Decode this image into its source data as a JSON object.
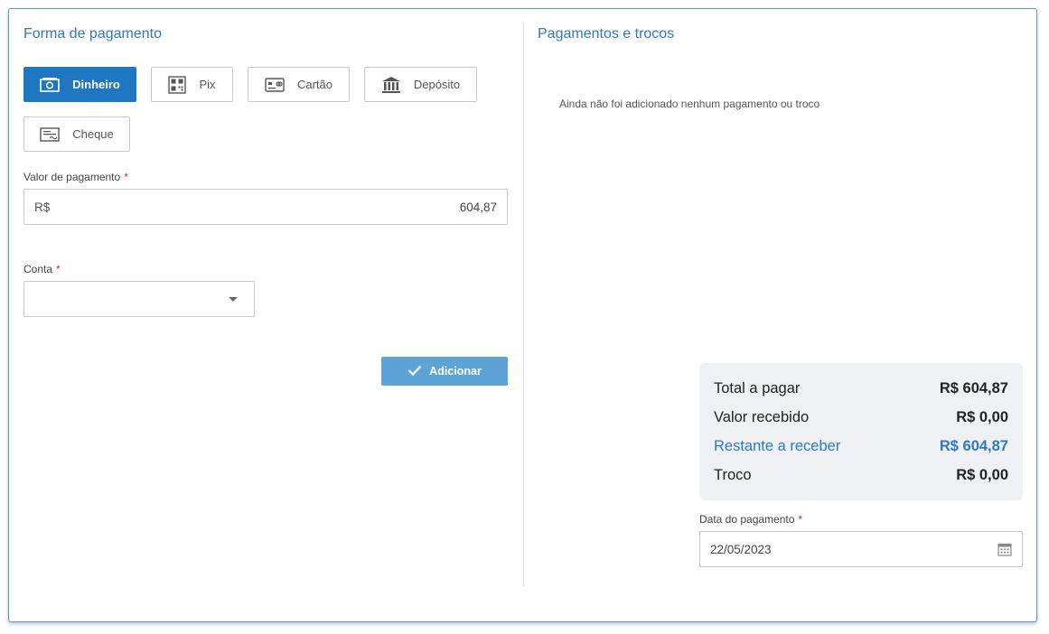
{
  "left": {
    "title": "Forma de pagamento",
    "methods": [
      {
        "label": "Dinheiro",
        "icon": "cash-icon",
        "active": true
      },
      {
        "label": "Pix",
        "icon": "qr-code-icon",
        "active": false
      },
      {
        "label": "Cartão",
        "icon": "card-icon",
        "active": false
      },
      {
        "label": "Depósito",
        "icon": "bank-icon",
        "active": false
      },
      {
        "label": "Cheque",
        "icon": "check-icon",
        "active": false
      }
    ],
    "amount": {
      "label": "Valor de pagamento",
      "required_mark": "*",
      "prefix": "R$",
      "value": "604,87"
    },
    "account": {
      "label": "Conta",
      "required_mark": "*",
      "value": ""
    },
    "add_button": "Adicionar"
  },
  "right": {
    "title": "Pagamentos e trocos",
    "empty_message": "Ainda não foi adicionado nenhum pagamento ou troco",
    "summary": [
      {
        "label": "Total a pagar",
        "value": "R$ 604,87"
      },
      {
        "label": "Valor recebido",
        "value": "R$ 0,00"
      },
      {
        "label": "Restante a receber",
        "value": "R$ 604,87"
      },
      {
        "label": "Troco",
        "value": "R$ 0,00"
      }
    ],
    "date": {
      "label": "Data do pagamento",
      "required_mark": "*",
      "value": "22/05/2023"
    }
  },
  "colors": {
    "accent": "#1f77c1",
    "title": "#2f78be",
    "required": "#c0392b",
    "add_button": "#5ea3d6"
  }
}
